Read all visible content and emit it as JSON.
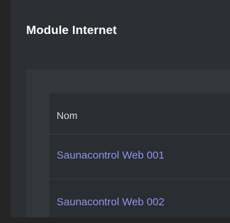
{
  "window": {
    "title": "Module Internet"
  },
  "table": {
    "columns": [
      "Nom"
    ],
    "rows": [
      {
        "name": "Saunacontrol Web 001"
      },
      {
        "name": "Saunacontrol Web 002"
      }
    ]
  },
  "colors": {
    "page_background": "#252525",
    "window_background": "#2c2f33",
    "panel_background": "#33363b",
    "table_background": "#2a2d31",
    "link": "#8e95ee",
    "title_text": "#ffffff"
  }
}
